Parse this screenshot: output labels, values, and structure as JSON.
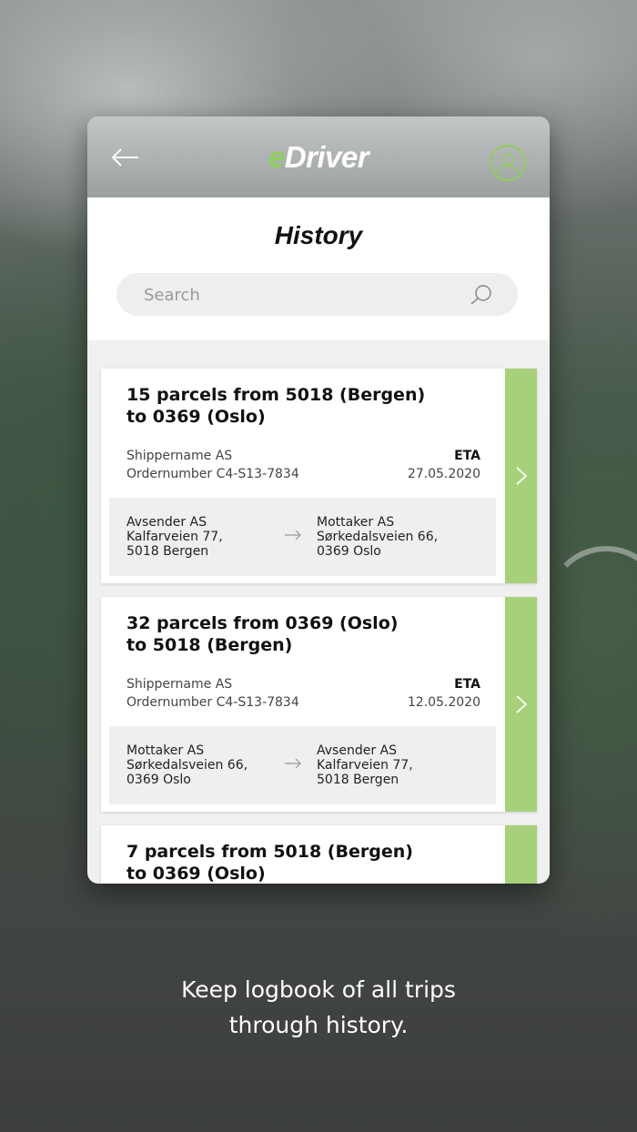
{
  "app": {
    "logo_e": "e",
    "logo_rest": "Driver"
  },
  "page": {
    "title": "History"
  },
  "search": {
    "placeholder": "Search"
  },
  "cards": [
    {
      "title_line1": "15 parcels from 5018 (Bergen)",
      "title_line2": "to 0369 (Oslo)",
      "shipper": "Shippername  AS",
      "order": "Ordernumber C4-S13-7834",
      "eta_label": "ETA",
      "eta_date": "27.05.2020",
      "from": {
        "name": "Avsender AS",
        "street": "Kalfarveien 77,",
        "city": "5018 Bergen"
      },
      "to": {
        "name": "Mottaker AS",
        "street": "Sørkedalsveien 66,",
        "city": "0369 Oslo"
      }
    },
    {
      "title_line1": "32 parcels from 0369 (Oslo)",
      "title_line2": "to 5018 (Bergen)",
      "shipper": "Shippername  AS",
      "order": "Ordernumber C4-S13-7834",
      "eta_label": "ETA",
      "eta_date": "12.05.2020",
      "from": {
        "name": "Mottaker AS",
        "street": "Sørkedalsveien 66,",
        "city": "0369 Oslo"
      },
      "to": {
        "name": "Avsender AS",
        "street": "Kalfarveien 77,",
        "city": "5018 Bergen"
      }
    },
    {
      "title_line1": "7 parcels from 5018 (Bergen)",
      "title_line2": "to 0369 (Oslo)"
    }
  ],
  "caption": {
    "line1": "Keep logbook of all trips",
    "line2": "through history."
  },
  "colors": {
    "accent_green": "#a6d17a",
    "logo_green": "#8fcf5a"
  },
  "icons": [
    "back-arrow-icon",
    "profile-icon",
    "search-icon",
    "chevron-right-icon",
    "route-arrow-icon"
  ]
}
